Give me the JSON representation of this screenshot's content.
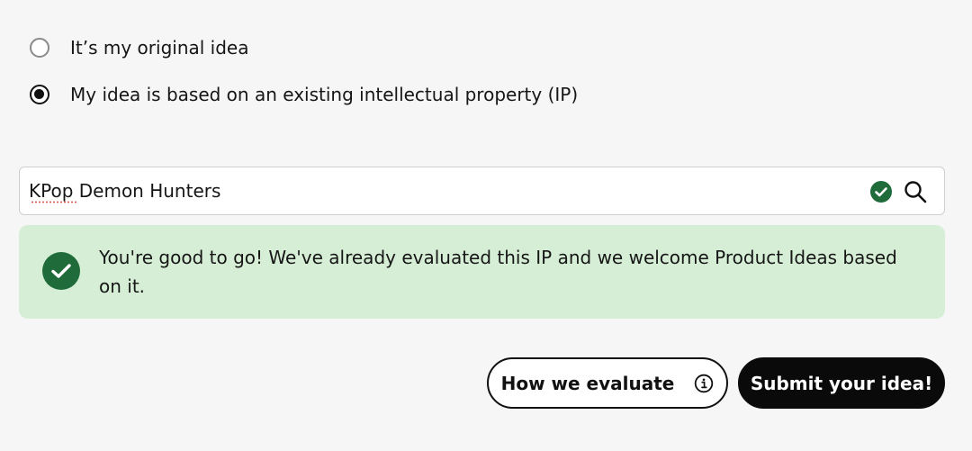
{
  "ip_question": {
    "options": [
      {
        "label": "It’s my original idea",
        "selected": false
      },
      {
        "label": "My idea is based on an existing intellectual property (IP)",
        "selected": true
      }
    ]
  },
  "ip_search": {
    "value": "KPop Demon Hunters",
    "status": "valid"
  },
  "status_message": {
    "text": "You're good to go! We've already evaluated this IP and we welcome Product Ideas based on it."
  },
  "actions": {
    "how_we_evaluate_label": "How we evaluate",
    "submit_label": "Submit your idea!"
  },
  "colors": {
    "success_green": "#1f6b3a",
    "success_bg": "#d6eed6",
    "primary_button": "#0a0a0a",
    "page_bg": "#f6f6f6"
  },
  "icons": {
    "valid": "check-circle-icon",
    "search": "search-icon",
    "info": "info-icon"
  }
}
